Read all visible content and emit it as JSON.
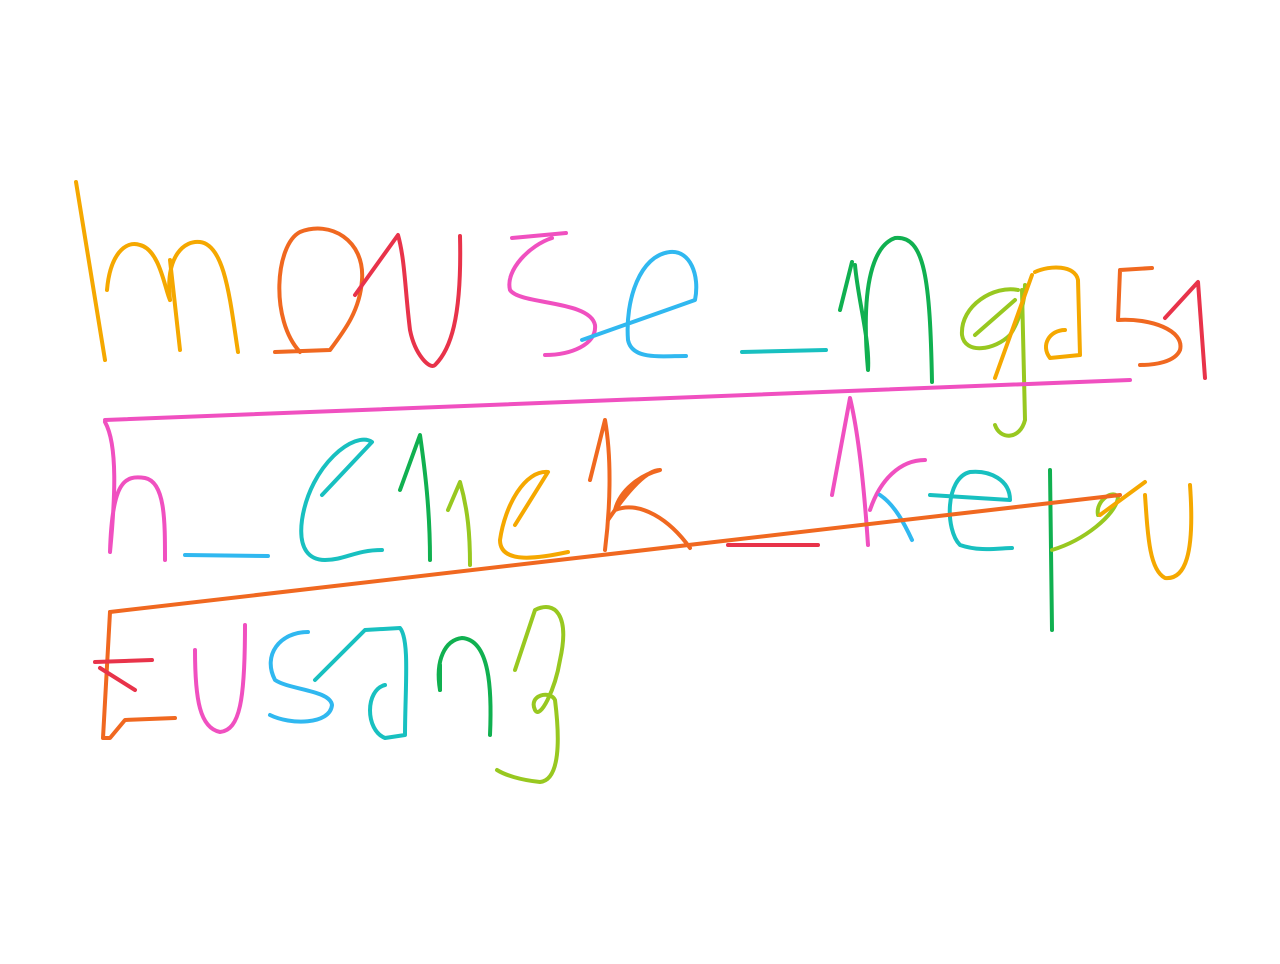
{
  "handwriting": {
    "lines": [
      "mouse_ngasi",
      "h_click_kepu",
      "Eusang"
    ]
  },
  "palette": {
    "orange": "#f5a800",
    "red": "#e8334a",
    "pink": "#f050c0",
    "blue": "#30b8f0",
    "teal": "#18c0c0",
    "green": "#10b050",
    "lime": "#98c820",
    "deep_orange": "#f06820"
  }
}
